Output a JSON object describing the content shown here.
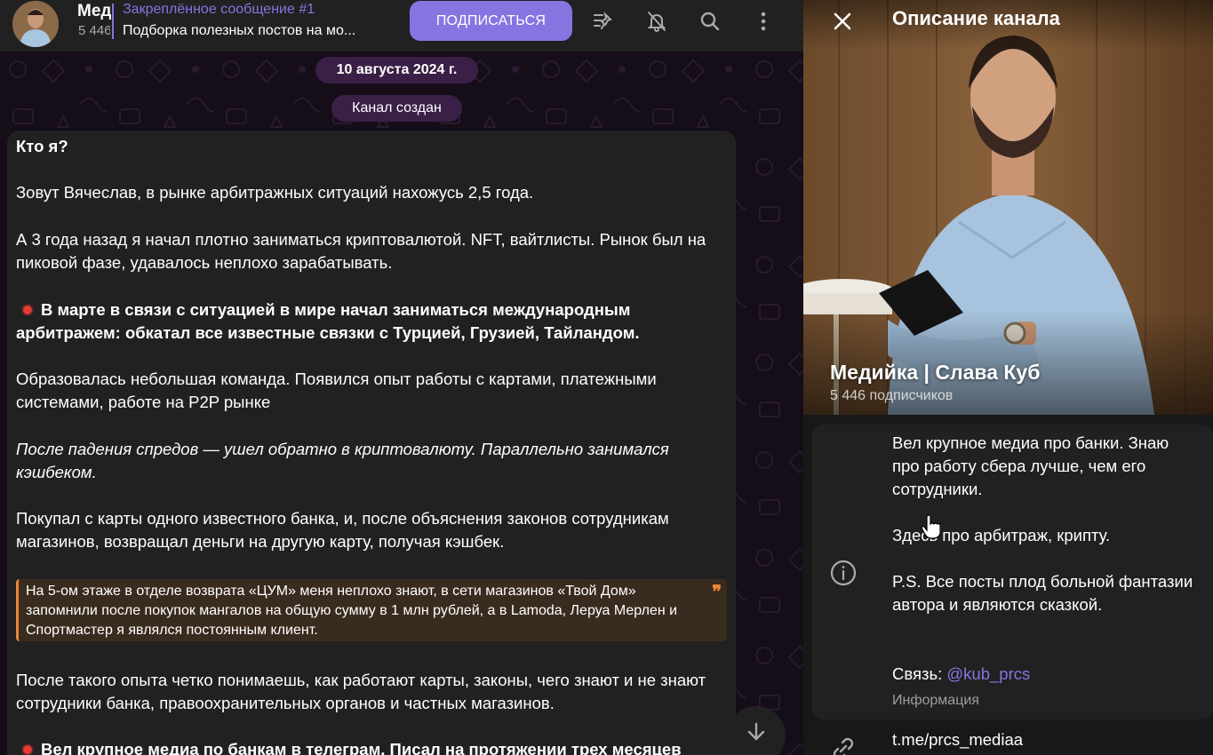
{
  "channel": {
    "title": "Медийка | Слава Куб",
    "title_short": "Мед",
    "subscribers_short": "5 446",
    "subscribe_label": "ПОДПИСАТЬСЯ"
  },
  "pinned": {
    "title": "Закреплённое сообщение #1",
    "text": "Подборка полезных постов на мо..."
  },
  "header_icons": [
    "pinned-list-icon",
    "mute-bell-icon",
    "search-icon",
    "more-vertical-icon"
  ],
  "service": {
    "date": "10 августа 2024 г.",
    "created": "Канал создан"
  },
  "post": {
    "heading": "Кто я?",
    "p1": "Зовут Вячеслав, в рынке арбитражных ситуаций нахожусь 2,5 года.",
    "p2": "А 3 года назад я начал плотно заниматься криптовалютой. NFT, вайтлисты. Рынок был на пиковой фазе, удавалось неплохо зарабатывать.",
    "p3": "В марте в связи с ситуацией в мире начал заниматься международным арбитражем: обкатал все известные связки с Турцией, Грузией, Тайландом.",
    "p4": "Образовалась небольшая команда. Появился опыт работы с картами, платежными системами, работе на P2P рынке",
    "p5": "После падения спредов — ушел обратно в криптовалюту. Параллельно занимался кэшбеком.",
    "p6": "Покупал с карты одного известного банка, и, после объяснения законов сотрудникам магазинов, возвращал деньги на другую карту, получая кэшбек.",
    "quote": "На 5-ом этаже в отделе возврата «ЦУМ» меня неплохо знают, в сети магазинов «Твой Дом» запомнили после покупок мангалов на общую сумму в 1 млн рублей, а в Lamoda, Леруа Мерлен и Спортмастер я являлся постоянным клиент.",
    "p7": "После такого опыта четко понимаешь, как работают карты, законы, чего знают и не знают сотрудники банка, правоохранительных органов и частных магазинов.",
    "p8": "Вел крупное медиа по банкам в телеграм. Писал на протяжении трех месяцев"
  },
  "panel": {
    "title": "Описание канала",
    "name": "Медийка | Слава Куб",
    "subscribers": "5 446 подписчиков",
    "description": "Вел крупное медиа про банки. Знаю про работу сбера лучше, чем его сотрудники.\n\nЗдесь про арбитраж, крипту.\n\nP.S. Все посты плод больной фантазии автора и являются сказкой.",
    "contact_label": "Связь:",
    "contact_link": "@kub_prcs",
    "info_caption": "Информация",
    "link": "t.me/prcs_mediaa"
  },
  "colors": {
    "accent": "#8774e1",
    "bubble": "#212121",
    "quote_border": "#e8873a",
    "date_pill": "#3a1f46"
  }
}
